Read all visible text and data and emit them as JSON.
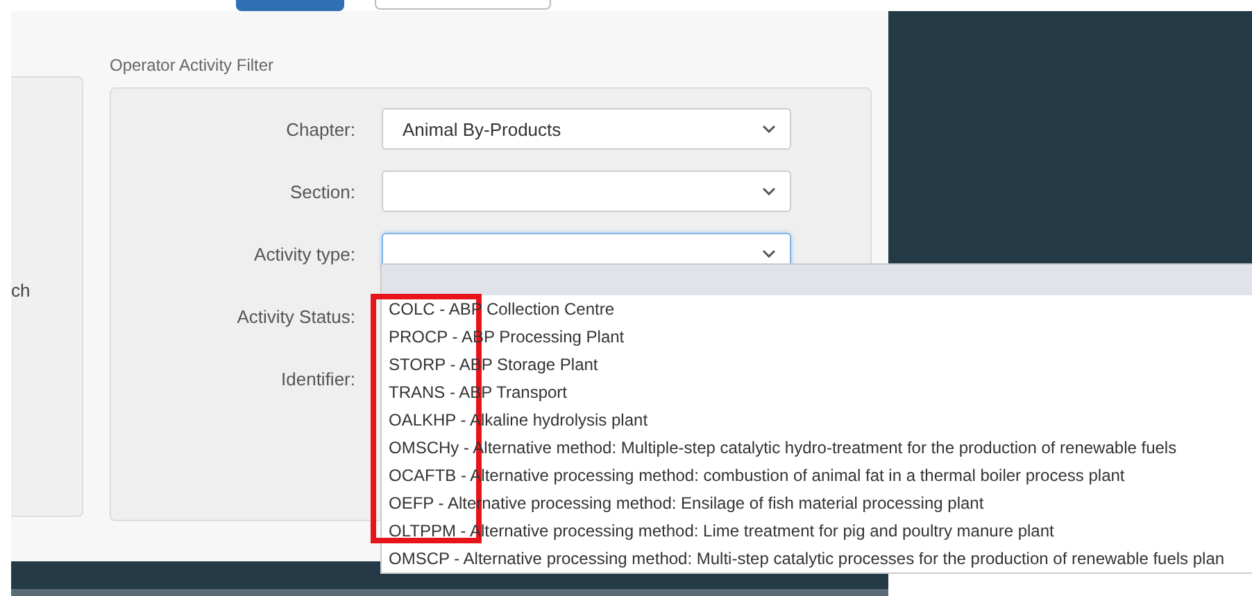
{
  "top_buttons": [
    {
      "kind": "primary"
    },
    {
      "kind": "secondary"
    }
  ],
  "left_panel": {
    "text": "ch"
  },
  "filter": {
    "title": "Operator Activity Filter",
    "fields": [
      {
        "label": "Chapter:",
        "kind": "select",
        "value": "Animal By-Products",
        "focused": false
      },
      {
        "label": "Section:",
        "kind": "select",
        "focused": false
      },
      {
        "label": "Activity type:",
        "kind": "select",
        "focused": true
      },
      {
        "label": "Activity Status:",
        "kind": "label"
      },
      {
        "label": "Identifier:",
        "kind": "label"
      }
    ]
  },
  "dropdown": {
    "options": [
      "COLC - ABP Collection Centre",
      "PROCP - ABP Processing Plant",
      "STORP - ABP Storage Plant",
      "TRANS - ABP Transport",
      "OALKHP - Alkaline hydrolysis plant",
      "OMSCHy - Alternative method: Multiple-step catalytic hydro-treatment for the production of renewable fuels",
      "OCAFTB - Alternative processing method: combustion of animal fat in a thermal boiler process plant",
      "OEFP - Alternative processing method: Ensilage of fish material processing plant",
      "OLTPPM - Alternative processing method: Lime treatment for pig and poultry manure plant",
      "OMSCP - Alternative processing method: Multi-step catalytic processes for the production of renewable fuels plan"
    ]
  }
}
